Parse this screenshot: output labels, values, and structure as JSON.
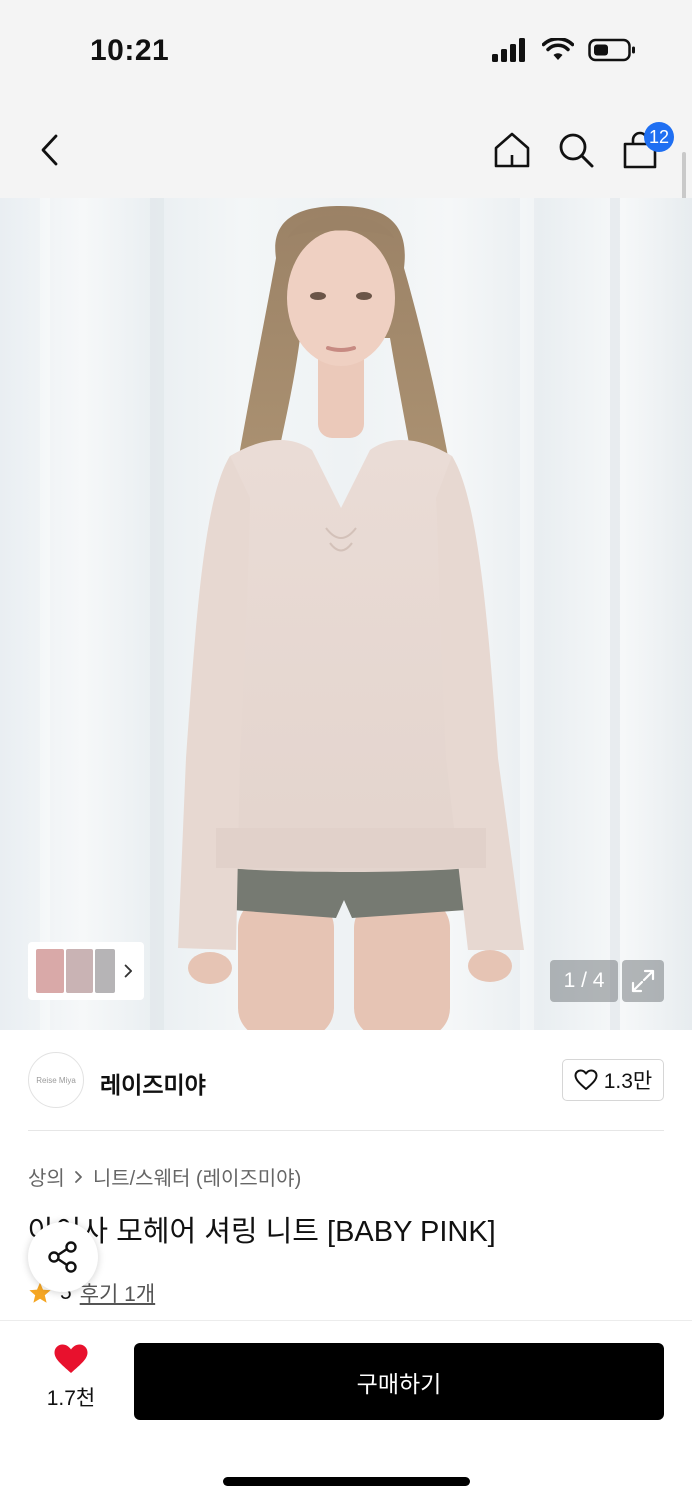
{
  "status": {
    "time": "10:21"
  },
  "nav": {
    "cart_count": "12"
  },
  "gallery": {
    "counter": "1 / 4"
  },
  "brand": {
    "logo_text": "Reise Miya",
    "name": "레이즈미야",
    "likes": "1.3만"
  },
  "breadcrumb": {
    "level1": "상의",
    "level2": "니트/스웨터 (레이즈미야)"
  },
  "product": {
    "title": "아이사 모헤어 셔링 니트 [BABY PINK]",
    "rating": "5",
    "review_link": "후기 1개"
  },
  "bottom": {
    "wish_count": "1.7천",
    "buy_label": "구매하기"
  },
  "colors": {
    "accent_badge": "#1f6ff2",
    "heart": "#e8112d",
    "star": "#f5a623",
    "buy_button": "#000000"
  },
  "icons": [
    "signal-icon",
    "wifi-icon",
    "battery-icon",
    "back-icon",
    "home-icon",
    "search-icon",
    "cart-icon",
    "chevron-right-icon",
    "expand-icon",
    "heart-outline-icon",
    "star-icon",
    "share-icon",
    "heart-filled-icon"
  ]
}
